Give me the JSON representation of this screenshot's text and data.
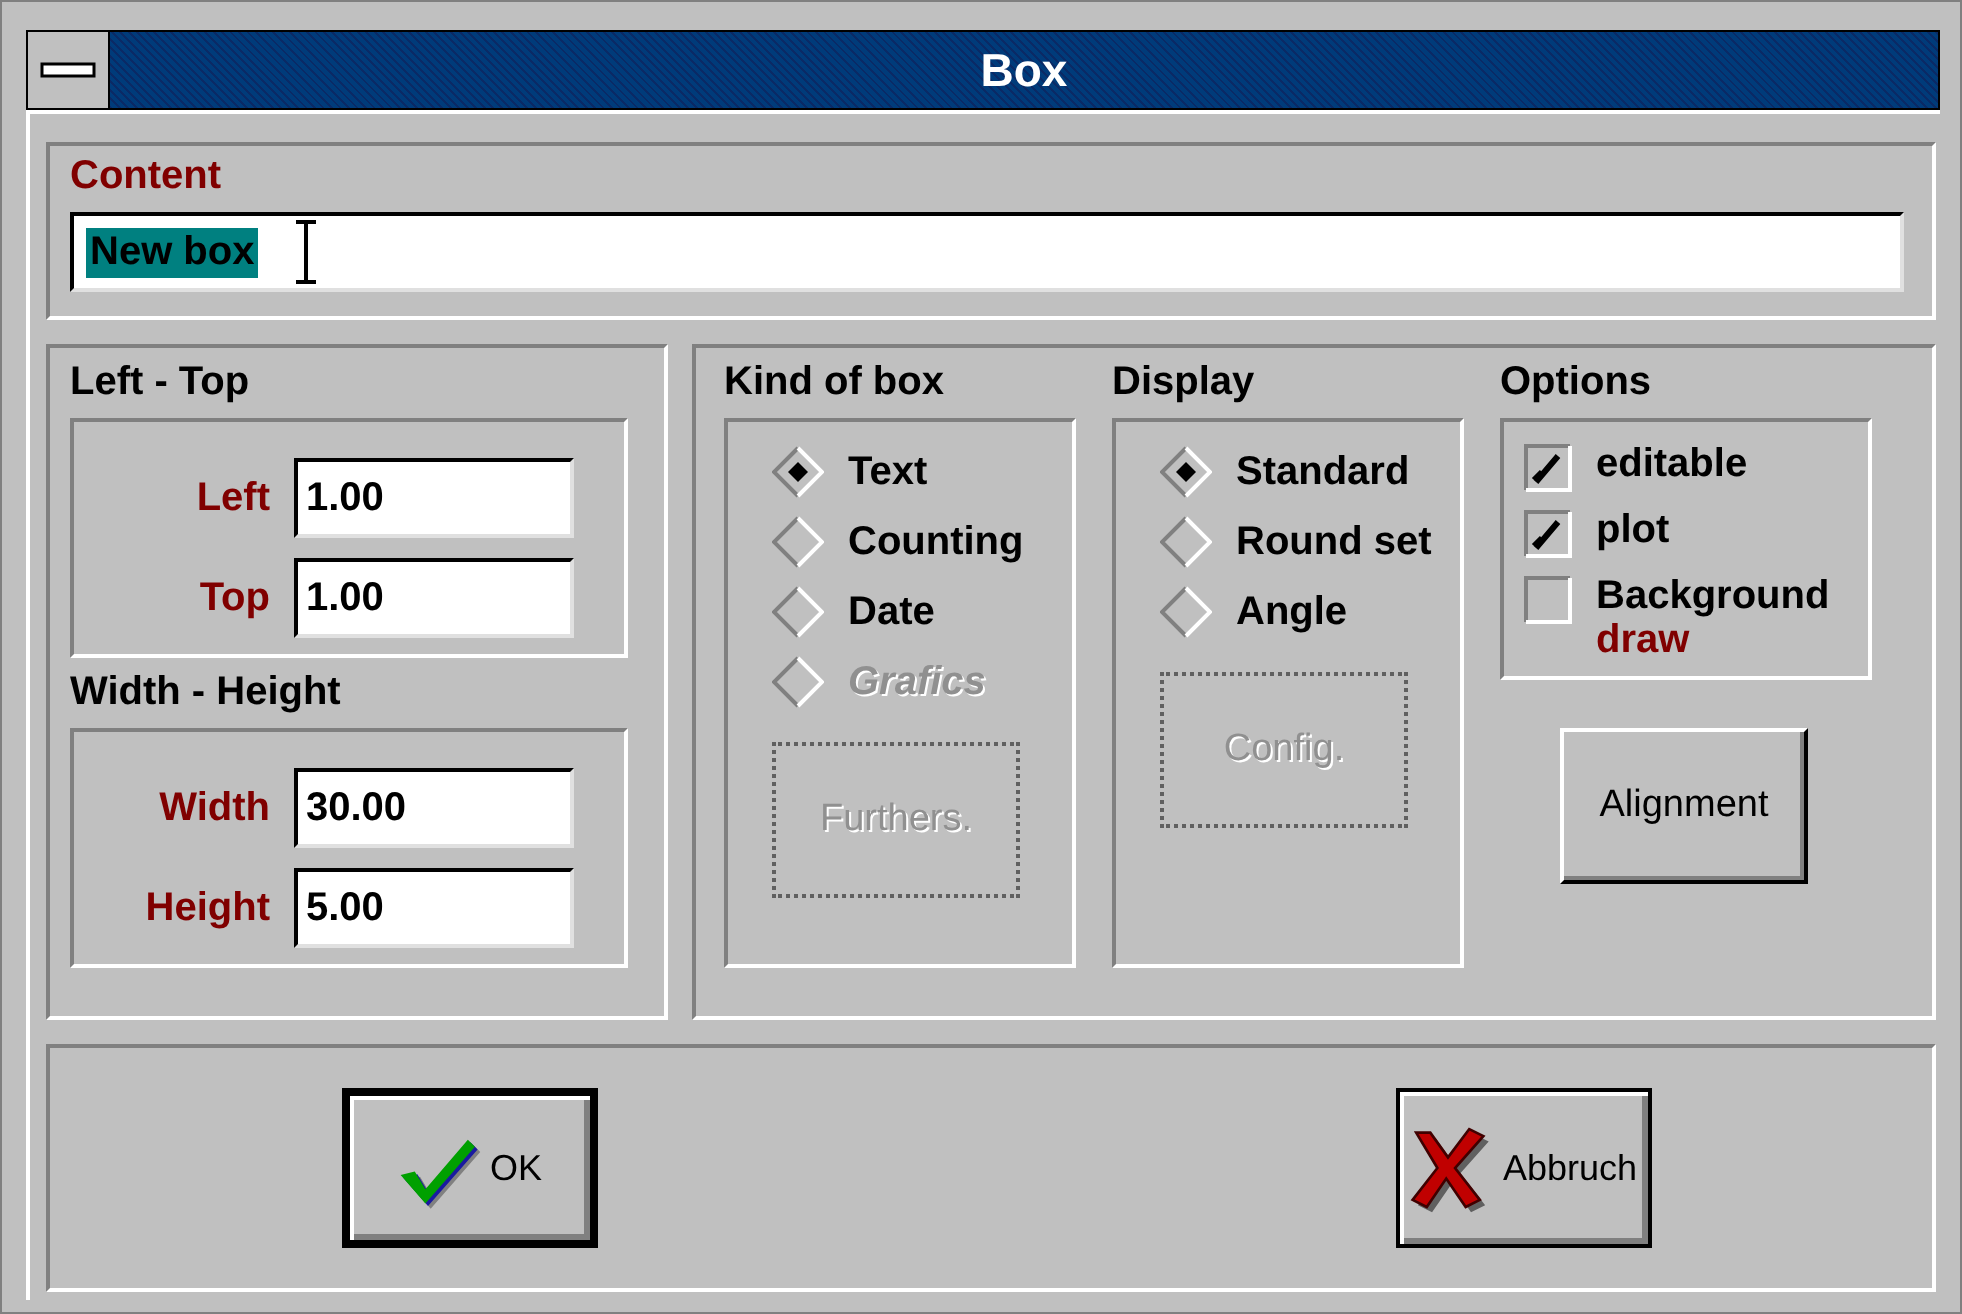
{
  "window": {
    "title": "Box"
  },
  "content": {
    "label": "Content",
    "value": "New box",
    "selected": true
  },
  "position": {
    "title": "Left - Top",
    "fields": [
      {
        "label": "Left",
        "value": "1.00"
      },
      {
        "label": "Top",
        "value": "1.00"
      }
    ]
  },
  "size": {
    "title": "Width - Height",
    "fields": [
      {
        "label": "Width",
        "value": "30.00"
      },
      {
        "label": "Height",
        "value": "5.00"
      }
    ]
  },
  "kind_of_box": {
    "title": "Kind of box",
    "options": [
      {
        "label": "Text",
        "selected": true,
        "disabled": false
      },
      {
        "label": "Counting",
        "selected": false,
        "disabled": false
      },
      {
        "label": "Date",
        "selected": false,
        "disabled": false
      },
      {
        "label": "Grafics",
        "selected": false,
        "disabled": true
      }
    ],
    "button": {
      "label": "Furthers.",
      "disabled": true
    }
  },
  "display": {
    "title": "Display",
    "options": [
      {
        "label": "Standard",
        "selected": true,
        "disabled": false
      },
      {
        "label": "Round set",
        "selected": false,
        "disabled": false
      },
      {
        "label": "Angle",
        "selected": false,
        "disabled": false
      }
    ],
    "button": {
      "label": "Config.",
      "disabled": true
    }
  },
  "options": {
    "title": "Options",
    "items": [
      {
        "label": "editable",
        "checked": true
      },
      {
        "label": "plot",
        "checked": true
      },
      {
        "label": "Background",
        "sublabel": "draw",
        "checked": false
      }
    ],
    "button": {
      "label": "Alignment"
    }
  },
  "buttons": [
    {
      "kind": "ok",
      "label": "OK",
      "default": true
    },
    {
      "kind": "cancel",
      "label": "Abbruch",
      "default": false
    }
  ]
}
